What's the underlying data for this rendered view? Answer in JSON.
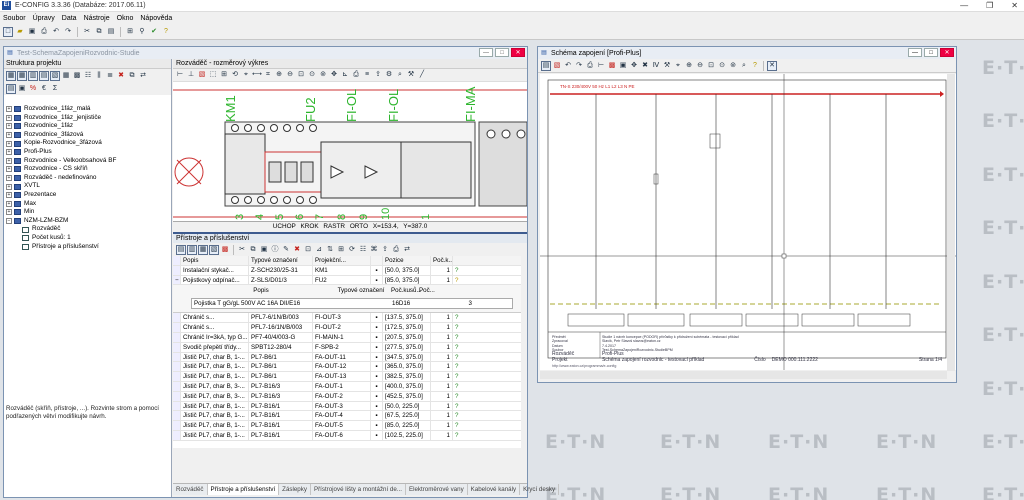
{
  "app": {
    "title": "E-CONFIG 3.3.36  (Databáze: 2017.06.11)",
    "icon_label": "Ei",
    "window_controls": [
      "—",
      "❐",
      "✕"
    ]
  },
  "menu": [
    "Soubor",
    "Úpravy",
    "Data",
    "Nástroje",
    "Okno",
    "Nápověda"
  ],
  "project_window": {
    "title": "Test-SchemaZapojeniRozvodnic-Studie",
    "tree_header": "Struktura projektu",
    "tree": [
      {
        "label": "Rozvodnice_1fáz_malá",
        "level": 0
      },
      {
        "label": "Rozvodnice_1fáz_jenjističe",
        "level": 0
      },
      {
        "label": "Rozvodnice_1fáz",
        "level": 0
      },
      {
        "label": "Rozvodnice_3fázová",
        "level": 0
      },
      {
        "label": "Kopie-Rozvodnice_3fázová",
        "level": 0
      },
      {
        "label": "Profi-Plus",
        "level": 0
      },
      {
        "label": "Rozvodnice - Velkoobsahová BF",
        "level": 0
      },
      {
        "label": "Rozvodnice - CS skříň",
        "level": 0
      },
      {
        "label": "Rozváděč - nedefinováno",
        "level": 0
      },
      {
        "label": "XVTL",
        "level": 0
      },
      {
        "label": "Prezentace",
        "level": 0
      },
      {
        "label": "Max",
        "level": 0
      },
      {
        "label": "Min",
        "level": 0
      },
      {
        "label": "NZM-LZM-BZM",
        "level": 0
      },
      {
        "label": "Rozváděč",
        "level": 1
      },
      {
        "label": "Počet kusů: 1",
        "level": 1
      },
      {
        "label": "Přístroje a příslušenství",
        "level": 1
      }
    ],
    "hint": "Rozváděč (skříň, přístroje, ...). Rozvinte strom a pomocí podřazených větví modifikujte návrh.",
    "drawing_header": "Rozváděč - rozměrový výkres",
    "drawing_labels": [
      "KM1",
      "FU2",
      "FI-OL",
      "FI-OL",
      "FI-MA"
    ],
    "drawing_numbers": [
      "3",
      "4",
      "5",
      "6",
      "7",
      "8",
      "9",
      "10",
      "1"
    ],
    "status": {
      "uchop": "UCHOP",
      "krok": "KROK",
      "rastr": "RASTR",
      "orto": "ORTO",
      "coords": "X=153.4, Y=387.0"
    },
    "devices_header": "Přístroje a příslušenství",
    "columns": [
      "Popis",
      "Typové označení",
      "Projekční...",
      "Pozice",
      "Poč.k..."
    ],
    "rows": [
      {
        "popis": "Instalační stykač...",
        "typ": "Z-SCH230/25-31",
        "proj": "KM1",
        "pozice": "[50.0, 375.0]",
        "pocet": "1"
      },
      {
        "popis": "Pojistkový odpínač...",
        "typ": "Z-SLS/D01/3",
        "proj": "FU2",
        "pozice": "[85.0, 375.0]",
        "pocet": "1"
      }
    ],
    "subgrid": {
      "columns": [
        "Popis",
        "Typové označení",
        "Poč.kusů...",
        "Poč..."
      ],
      "row": {
        "popis": "Pojistka T gG/gL 500V AC 16A DII/E16",
        "typ": "16D16",
        "pocet": "3"
      }
    },
    "rows2": [
      {
        "popis": "Chránič s...",
        "typ": "PFL7-6/1N/B/003",
        "proj": "FI-OUT-3",
        "pozice": "[137.5, 375.0]",
        "pocet": "1"
      },
      {
        "popis": "Chránič s...",
        "typ": "PFL7-16/1N/B/003",
        "proj": "FI-OUT-2",
        "pozice": "[172.5, 375.0]",
        "pocet": "1"
      },
      {
        "popis": "Chránič Ir=3kA, typ G...",
        "typ": "PF7-40/4/003-G",
        "proj": "FI-MAIN-1",
        "pozice": "[207.5, 375.0]",
        "pocet": "1"
      },
      {
        "popis": "Svodič přepětí třídy...",
        "typ": "SPBT12-280/4",
        "proj": "F-SPB-2",
        "pozice": "[277.5, 375.0]",
        "pocet": "1"
      },
      {
        "popis": "Jistič PL7, char B, 1-...",
        "typ": "PL7-B6/1",
        "proj": "FA-OUT-11",
        "pozice": "[347.5, 375.0]",
        "pocet": "1"
      },
      {
        "popis": "Jistič PL7, char B, 1-...",
        "typ": "PL7-B6/1",
        "proj": "FA-OUT-12",
        "pozice": "[365.0, 375.0]",
        "pocet": "1"
      },
      {
        "popis": "Jistič PL7, char B, 1-...",
        "typ": "PL7-B6/1",
        "proj": "FA-OUT-13",
        "pozice": "[382.5, 375.0]",
        "pocet": "1"
      },
      {
        "popis": "Jistič PL7, char B, 3-...",
        "typ": "PL7-B16/3",
        "proj": "FA-OUT-1",
        "pozice": "[400.0, 375.0]",
        "pocet": "1"
      },
      {
        "popis": "Jistič PL7, char B, 3-...",
        "typ": "PL7-B16/3",
        "proj": "FA-OUT-2",
        "pozice": "[452.5, 375.0]",
        "pocet": "1"
      },
      {
        "popis": "Jistič PL7, char B, 1-...",
        "typ": "PL7-B16/1",
        "proj": "FA-OUT-3",
        "pozice": "[50.0, 225.0]",
        "pocet": "1"
      },
      {
        "popis": "Jistič PL7, char B, 1-...",
        "typ": "PL7-B16/1",
        "proj": "FA-OUT-4",
        "pozice": "[67.5, 225.0]",
        "pocet": "1"
      },
      {
        "popis": "Jistič PL7, char B, 1-...",
        "typ": "PL7-B16/1",
        "proj": "FA-OUT-5",
        "pozice": "[85.0, 225.0]",
        "pocet": "1"
      },
      {
        "popis": "Jistič PL7, char B, 1-...",
        "typ": "PL7-B16/1",
        "proj": "FA-OUT-6",
        "pozice": "[102.5, 225.0]",
        "pocet": "1"
      }
    ],
    "tabs": [
      "Rozváděč",
      "Přístroje a příslušenství",
      "Záslepky",
      "Přístrojové lišty a montážní de...",
      "Elektroměrové vany",
      "Kabelové kanály",
      "Krycí desky"
    ]
  },
  "schema_window": {
    "title": "Schéma zapojení [Profi-Plus]",
    "busbar_label": "TN-S 230/400V 50 Hz L1 L2 L3 N PE",
    "title_block": {
      "rows": [
        {
          "k": "Předmět",
          "v": "Studie 1 návrh koncepce (PODOR) přírůstky k přidružení schémata - testovací příklad"
        },
        {
          "k": "Zpracoval",
          "v": "Slavík, Petr Slavoš slavos@eaton.cz"
        },
        {
          "k": "Datum",
          "v": "7.4.2017"
        },
        {
          "k": "Soubor",
          "v": "Test-SchemaZapojeniRozvodnic-StudieBPM"
        },
        {
          "k": "Rozváděč",
          "v": "Profi-Plus"
        },
        {
          "k": "Projekt",
          "v": "Schéma zapojení rozvodnic - testovací příklad"
        },
        {
          "k": "Číslo",
          "v": "DEMO 000.111.2222"
        }
      ],
      "footer": "http://www.eaton.cz/programma/e-config",
      "page": "Strana 1/4"
    }
  },
  "watermark": "E·T·N"
}
